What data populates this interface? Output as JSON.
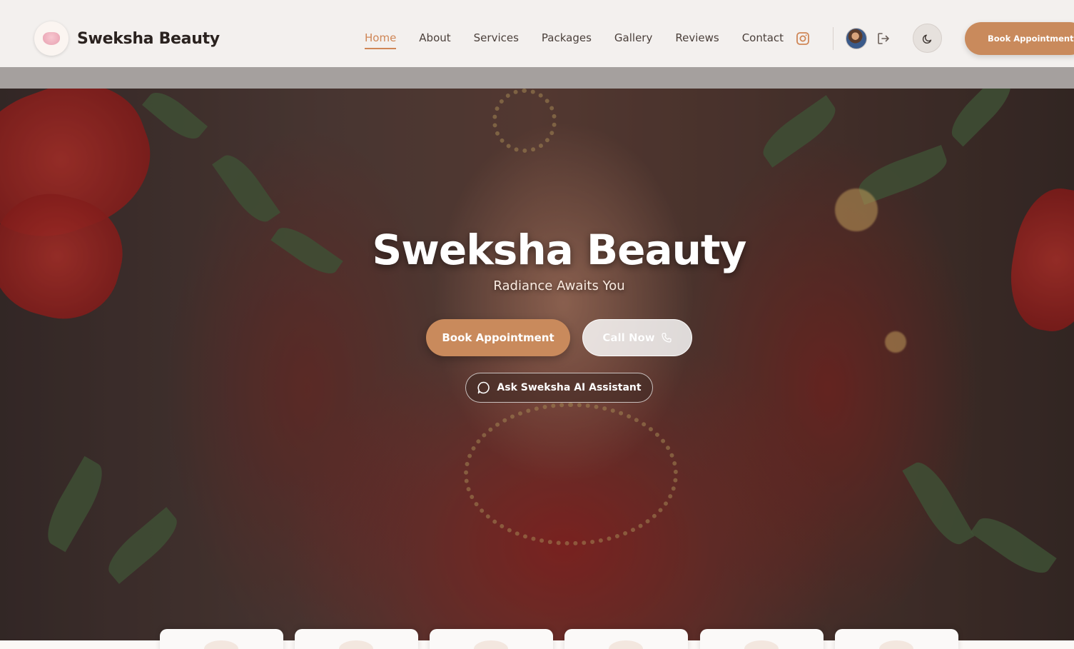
{
  "header": {
    "brand": "Sweksha Beauty",
    "nav": [
      {
        "label": "Home",
        "active": true
      },
      {
        "label": "About"
      },
      {
        "label": "Services"
      },
      {
        "label": "Packages"
      },
      {
        "label": "Gallery"
      },
      {
        "label": "Reviews"
      },
      {
        "label": "Contact"
      }
    ],
    "icons": {
      "instagram": "instagram-icon",
      "logout": "logout-icon",
      "theme": "moon-icon",
      "avatar": "user-avatar"
    },
    "book_label": "Book Appointment"
  },
  "hero": {
    "title": "Sweksha Beauty",
    "subtitle": "Radiance Awaits You",
    "book_label": "Book Appointment",
    "call_label": "Call Now",
    "ai_label": "Ask Sweksha AI Assistant"
  },
  "colors": {
    "accent": "#cf8656",
    "button": "#c98a5c",
    "header_bg": "#f3f0ee"
  }
}
